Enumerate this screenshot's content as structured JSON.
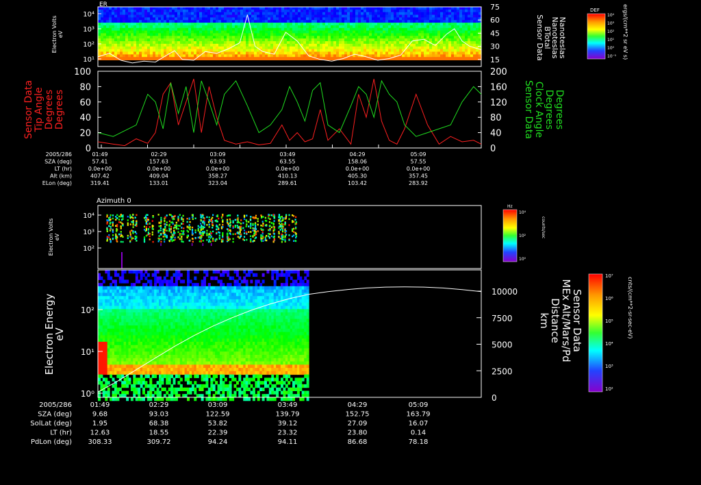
{
  "colors": {
    "background": "#000000",
    "text": "#ffffff",
    "tip_angle": "#ff2020",
    "clock_angle": "#20e020",
    "btotal": "#ffffff"
  },
  "chart_data": [
    {
      "type": "heatmap",
      "panel_tag": "ER",
      "ylabel": [
        "Electron Volts",
        "eV"
      ],
      "y_ticks": [
        "10⁴",
        "10³",
        "10²",
        "10¹"
      ],
      "right_axis_label": [
        "Sensor Data",
        "BTotal",
        "Nanoteslas",
        "Nanoteslas"
      ],
      "right_ticks": [
        "75",
        "60",
        "45",
        "30",
        "15"
      ],
      "right_ylim": [
        7,
        75
      ],
      "colorbar_title": "DEF",
      "colorbar_ticks": [
        "10⁴",
        "10³",
        "10²",
        "10¹",
        "10⁰",
        "10⁻¹"
      ],
      "colorbar_units": "ergs/(cm**2 sr eV s)",
      "series": [
        {
          "name": "BTotal",
          "x": [
            0,
            0.03,
            0.06,
            0.09,
            0.12,
            0.15,
            0.18,
            0.2,
            0.22,
            0.25,
            0.28,
            0.31,
            0.34,
            0.37,
            0.39,
            0.41,
            0.43,
            0.46,
            0.49,
            0.52,
            0.55,
            0.58,
            0.61,
            0.64,
            0.67,
            0.7,
            0.73,
            0.76,
            0.79,
            0.82,
            0.85,
            0.88,
            0.91,
            0.93,
            0.95,
            0.97,
            1.0
          ],
          "y": [
            18,
            22,
            14,
            11,
            13,
            12,
            20,
            25,
            15,
            14,
            24,
            22,
            27,
            34,
            66,
            30,
            24,
            21,
            46,
            36,
            19,
            15,
            13,
            16,
            21,
            18,
            14,
            16,
            20,
            36,
            38,
            31,
            44,
            50,
            36,
            30,
            26
          ]
        }
      ]
    },
    {
      "type": "line",
      "ylabel": [
        "Sensor Data",
        "Tip Angle",
        "Degrees",
        "Degrees"
      ],
      "y_ticks": [
        "100",
        "80",
        "60",
        "40",
        "20",
        "0"
      ],
      "ylim": [
        0,
        100
      ],
      "y2label": [
        "Sensor Data",
        "Clock Angle",
        "Degrees",
        "Degrees"
      ],
      "y2_ticks": [
        "200",
        "160",
        "120",
        "80",
        "40",
        "0"
      ],
      "y2lim": [
        0,
        200
      ],
      "series": [
        {
          "name": "Tip Angle",
          "x": [
            0,
            0.04,
            0.07,
            0.1,
            0.13,
            0.15,
            0.17,
            0.19,
            0.21,
            0.23,
            0.25,
            0.27,
            0.29,
            0.31,
            0.33,
            0.36,
            0.39,
            0.42,
            0.45,
            0.48,
            0.5,
            0.52,
            0.54,
            0.56,
            0.58,
            0.6,
            0.63,
            0.66,
            0.68,
            0.7,
            0.72,
            0.74,
            0.76,
            0.78,
            0.8,
            0.83,
            0.86,
            0.89,
            0.92,
            0.95,
            0.98,
            1.0
          ],
          "y": [
            8,
            5,
            3,
            12,
            6,
            20,
            70,
            85,
            30,
            60,
            90,
            20,
            80,
            40,
            10,
            5,
            8,
            4,
            6,
            30,
            10,
            20,
            8,
            12,
            50,
            10,
            25,
            5,
            70,
            40,
            90,
            35,
            10,
            5,
            25,
            70,
            30,
            5,
            15,
            8,
            10,
            5
          ]
        },
        {
          "name": "Clock Angle",
          "x": [
            0,
            0.04,
            0.07,
            0.1,
            0.13,
            0.15,
            0.17,
            0.19,
            0.21,
            0.23,
            0.25,
            0.27,
            0.29,
            0.31,
            0.33,
            0.36,
            0.39,
            0.42,
            0.45,
            0.48,
            0.5,
            0.52,
            0.54,
            0.56,
            0.58,
            0.6,
            0.63,
            0.66,
            0.68,
            0.7,
            0.72,
            0.74,
            0.76,
            0.78,
            0.8,
            0.83,
            0.86,
            0.89,
            0.92,
            0.95,
            0.98,
            1.0
          ],
          "y": [
            40,
            30,
            45,
            60,
            140,
            120,
            50,
            170,
            90,
            160,
            40,
            175,
            120,
            60,
            140,
            175,
            110,
            40,
            60,
            100,
            160,
            120,
            70,
            150,
            170,
            60,
            40,
            110,
            160,
            140,
            80,
            175,
            140,
            120,
            60,
            30,
            40,
            50,
            60,
            120,
            160,
            140
          ]
        }
      ]
    },
    {
      "type": "table",
      "row_labels": [
        "2005/286",
        "SZA (deg)",
        "LT (hr)",
        "Alt (km)",
        "ELon (deg)"
      ],
      "columns": [
        [
          "01:49",
          "57.41",
          "0.0e+00",
          "407.42",
          "319.41"
        ],
        [
          "02:29",
          "157.63",
          "0.0e+00",
          "409.04",
          "133.01"
        ],
        [
          "03:09",
          "63.93",
          "0.0e+00",
          "358.27",
          "323.04"
        ],
        [
          "03:49",
          "63.55",
          "0.0e+00",
          "410.13",
          "289.61"
        ],
        [
          "04:29",
          "158.06",
          "0.0e+00",
          "405.30",
          "103.42"
        ],
        [
          "05:09",
          "57.55",
          "0.0e+00",
          "357.45",
          "283.92"
        ]
      ]
    },
    {
      "type": "heatmap",
      "title": "Azimuth 0",
      "ylabel": [
        "Electron Volts",
        "eV"
      ],
      "y_ticks": [
        "10⁴",
        "10³",
        "10²"
      ],
      "colorbar_title": "Hz",
      "colorbar_ticks": [
        "10⁴",
        "10²",
        "10⁰"
      ],
      "colorbar_units": "counts/sec",
      "data_extent_fraction": 0.52
    },
    {
      "type": "heatmap",
      "ylabel": [
        "Electron Energy",
        "eV"
      ],
      "y_ticks": [
        "10²",
        "10¹",
        "10⁰"
      ],
      "right_axis_label": [
        "Sensor Data",
        "MEx Alt/Mars/Pd",
        "Distance",
        "km"
      ],
      "right_ticks": [
        "10000",
        "7500",
        "5000",
        "2500",
        "0"
      ],
      "right_ylim": [
        0,
        12000
      ],
      "colorbar_ticks": [
        "10⁷",
        "10⁶",
        "10⁵",
        "10⁴",
        "10³",
        "10²"
      ],
      "colorbar_units": "cnts/(cm**2-sr-sec-eV)",
      "data_extent_fraction": 0.55,
      "series": [
        {
          "name": "MEx Alt",
          "x": [
            0,
            0.05,
            0.1,
            0.15,
            0.2,
            0.25,
            0.3,
            0.35,
            0.4,
            0.45,
            0.5,
            0.55,
            0.6,
            0.65,
            0.7,
            0.75,
            0.8,
            0.85,
            0.9,
            0.95,
            1.0
          ],
          "y": [
            500,
            1500,
            2600,
            3700,
            4800,
            5800,
            6700,
            7500,
            8200,
            8800,
            9300,
            9700,
            9950,
            10150,
            10300,
            10380,
            10400,
            10380,
            10300,
            10150,
            9950
          ]
        }
      ]
    },
    {
      "type": "table",
      "row_labels": [
        "2005/286",
        "SZA (deg)",
        "SolLat (deg)",
        "LT (hr)",
        "PdLon (deg)"
      ],
      "columns": [
        [
          "01:49",
          "9.68",
          "1.95",
          "12.63",
          "308.33"
        ],
        [
          "02:29",
          "93.03",
          "68.38",
          "18.55",
          "309.72"
        ],
        [
          "03:09",
          "122.59",
          "53.82",
          "22.39",
          "94.24"
        ],
        [
          "03:49",
          "139.79",
          "39.12",
          "23.32",
          "94.11"
        ],
        [
          "04:29",
          "152.75",
          "27.09",
          "23.80",
          "86.68"
        ],
        [
          "05:09",
          "163.79",
          "16.07",
          "0.14",
          "78.18"
        ]
      ]
    }
  ]
}
